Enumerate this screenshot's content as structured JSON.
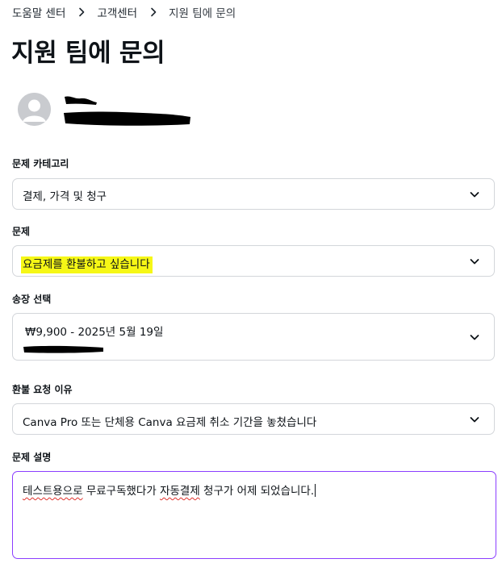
{
  "breadcrumb": {
    "items": [
      "도움말 센터",
      "고객센터"
    ],
    "current": "지원 팀에 문의"
  },
  "page": {
    "title": "지원 팀에 문의"
  },
  "form": {
    "category": {
      "label": "문제 카테고리",
      "value": "결제, 가격 및 청구"
    },
    "issue": {
      "label": "문제",
      "value": "요금제를 환불하고 싶습니다"
    },
    "invoice": {
      "label": "송장 선택",
      "value": "₩9,900 - 2025년 5월 19일"
    },
    "refund_reason": {
      "label": "환불 요청 이유",
      "value": "Canva Pro 또는 단체용 Canva 요금제 취소 기간을 놓쳤습니다"
    },
    "description": {
      "label": "문제 설명",
      "value_part1": "테스트용으로",
      "value_part2": " 무료구독했다가 ",
      "value_part3": "자동결제",
      "value_part4": " 청구가 어제 되었습니다."
    }
  },
  "colors": {
    "accent": "#8b3dff",
    "highlight": "#f6f716",
    "border": "#d3d6da",
    "spellcheck": "#e0332e"
  },
  "icons": {
    "separator": "chevron-right-icon",
    "dropdown": "chevron-down-icon",
    "avatar": "user-avatar-icon"
  }
}
